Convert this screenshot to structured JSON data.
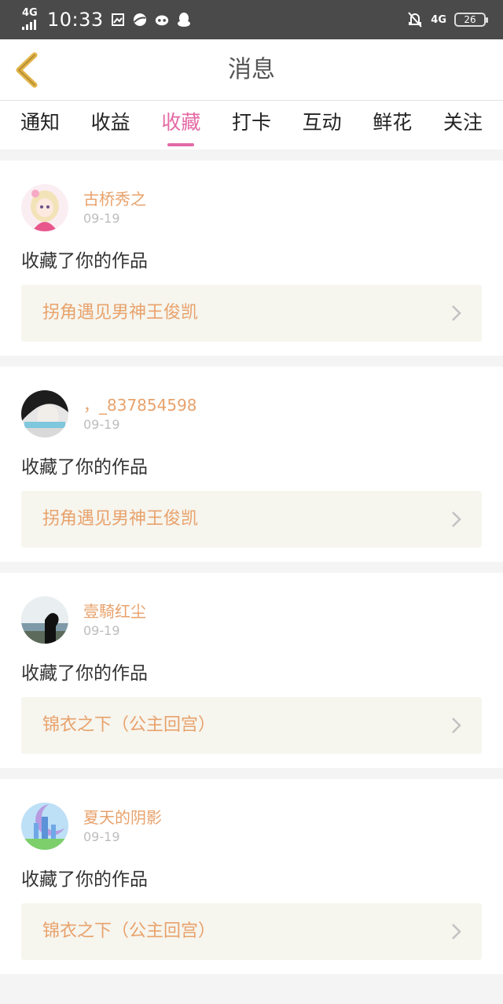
{
  "status_bar": {
    "network": "4G",
    "time": "10:33",
    "network_right": "4G",
    "battery": "26",
    "icons": [
      "4g-signal-icon",
      "gallery-icon",
      "browser-icon",
      "app-cat-icon",
      "qq-penguin-icon",
      "bell-off-icon",
      "battery-icon"
    ]
  },
  "header": {
    "title": "消息",
    "back_icon": "back-chevron-icon",
    "accent_color": "#e3b54a"
  },
  "tabs": [
    {
      "label": "通知",
      "active": false
    },
    {
      "label": "收益",
      "active": false
    },
    {
      "label": "收藏",
      "active": true
    },
    {
      "label": "打卡",
      "active": false
    },
    {
      "label": "互动",
      "active": false
    },
    {
      "label": "鲜花",
      "active": false
    },
    {
      "label": "关注",
      "active": false
    }
  ],
  "colors": {
    "active_tab": "#e36aa5",
    "username": "#e8a26c",
    "work_title": "#e8a26c",
    "work_bg": "#f6f5ee"
  },
  "messages": [
    {
      "username": "古桥秀之",
      "date": "09-19",
      "action": "收藏了你的作品",
      "work_title": "拐角遇见男神王俊凯",
      "avatar": "anime-girl-avatar"
    },
    {
      "username": "，_837854598",
      "date": "09-19",
      "action": "收藏了你的作品",
      "work_title": "拐角遇见男神王俊凯",
      "avatar": "face-photo-avatar"
    },
    {
      "username": "壹騎红尘",
      "date": "09-19",
      "action": "收藏了你的作品",
      "work_title": "锦衣之下（公主回宫）",
      "avatar": "silhouette-sea-avatar"
    },
    {
      "username": "夏天的阴影",
      "date": "09-19",
      "action": "收藏了你的作品",
      "work_title": "锦衣之下（公主回宫）",
      "avatar": "castle-avatar"
    }
  ]
}
